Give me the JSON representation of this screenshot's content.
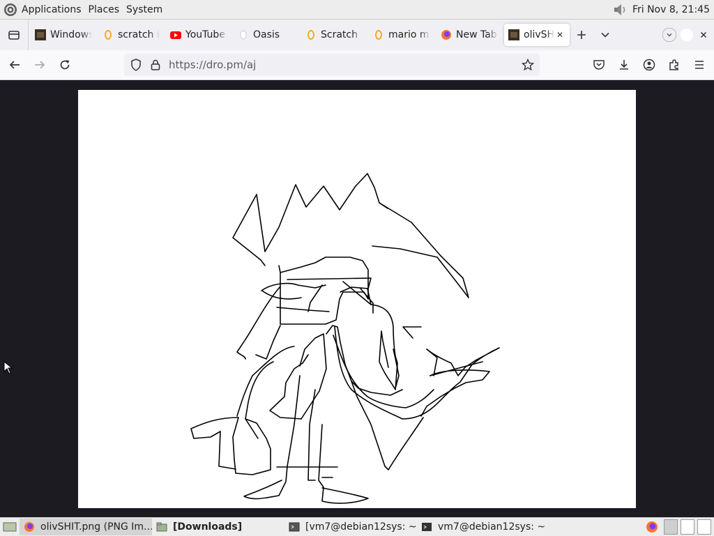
{
  "top_panel": {
    "menus": [
      "Applications",
      "Places",
      "System"
    ],
    "clock": "Fri Nov 8, 21:45",
    "icons": {
      "logo": "debian-swirl-icon",
      "volume": "volume-icon"
    }
  },
  "tabs": [
    {
      "title": "Windows",
      "icon": "image-thumb-icon",
      "active": false
    },
    {
      "title": "scratch image",
      "icon": "scratch-cat-icon",
      "active": false
    },
    {
      "title": "YouTube",
      "icon": "youtube-icon",
      "active": false
    },
    {
      "title": "Oasis",
      "icon": "oasis-icon",
      "active": false
    },
    {
      "title": "Scratch",
      "icon": "scratch-cat-icon",
      "active": false
    },
    {
      "title": "mario m",
      "icon": "scratch-cat-icon",
      "active": false
    },
    {
      "title": "New Tab",
      "icon": "firefox-icon",
      "active": false
    },
    {
      "title": "olivSHIT.png",
      "icon": "image-thumb-icon",
      "active": true
    }
  ],
  "nav": {
    "url": "https://dro.pm/aj",
    "icons": [
      "back-icon",
      "forward-icon",
      "reload-icon",
      "shield-icon",
      "lock-icon",
      "bookmark-star-icon",
      "pocket-icon",
      "download-icon",
      "account-icon",
      "extensions-icon",
      "menu-icon"
    ]
  },
  "taskbar": {
    "items": [
      {
        "label": "olivSHIT.png (PNG Im…",
        "icon": "firefox-icon",
        "active": true,
        "bold": false
      },
      {
        "label": "[Downloads]",
        "icon": "folder-icon",
        "active": false,
        "bold": true
      },
      {
        "label": "[vm7@debian12sys: ~]",
        "icon": "terminal-icon",
        "active": false,
        "bold": false
      },
      {
        "label": "vm7@debian12sys: ~",
        "icon": "terminal-icon",
        "active": false,
        "bold": false
      }
    ]
  },
  "colors": {
    "panel": "#ededed",
    "tabstrip": "#f0f0f4",
    "viewport_bg": "#1c1b22",
    "youtube_red": "#ff0000",
    "firefox_orange": "#ff7139",
    "scratch_yellow": "#f9a825"
  }
}
